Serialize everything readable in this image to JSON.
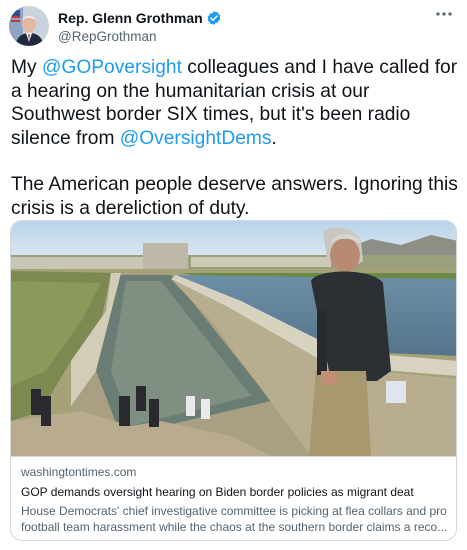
{
  "author": {
    "display_name": "Rep. Glenn Grothman",
    "handle": "@RepGrothman",
    "verified": true,
    "avatar_icon": "portrait-avatar"
  },
  "menu": {
    "icon": "more-horizontal-icon"
  },
  "tweet": {
    "p1_a": "My ",
    "p1_mention_1": "@GOPoversight",
    "p1_b": " colleagues and I have called for a hearing on the humanitarian crisis at our Southwest border SIX times, but it's been radio silence from ",
    "p1_mention_2": "@OversightDems",
    "p1_c": ".",
    "p2": "The American people deserve answers. Ignoring this crisis is a dereliction of duty."
  },
  "card": {
    "domain": "washingtontimes.com",
    "title": "GOP demands oversight hearing on Biden border policies as migrant deat",
    "description": "House Democrats' chief investigative committee is picking at flea collars and pro football team harassment while the chaos at the southern border claims a reco..."
  },
  "colors": {
    "link": "#1d9bf0",
    "verified_badge": "#1d9bf0",
    "secondary_text": "#536471",
    "primary_text": "#0f1419",
    "border": "#cfd9de"
  }
}
